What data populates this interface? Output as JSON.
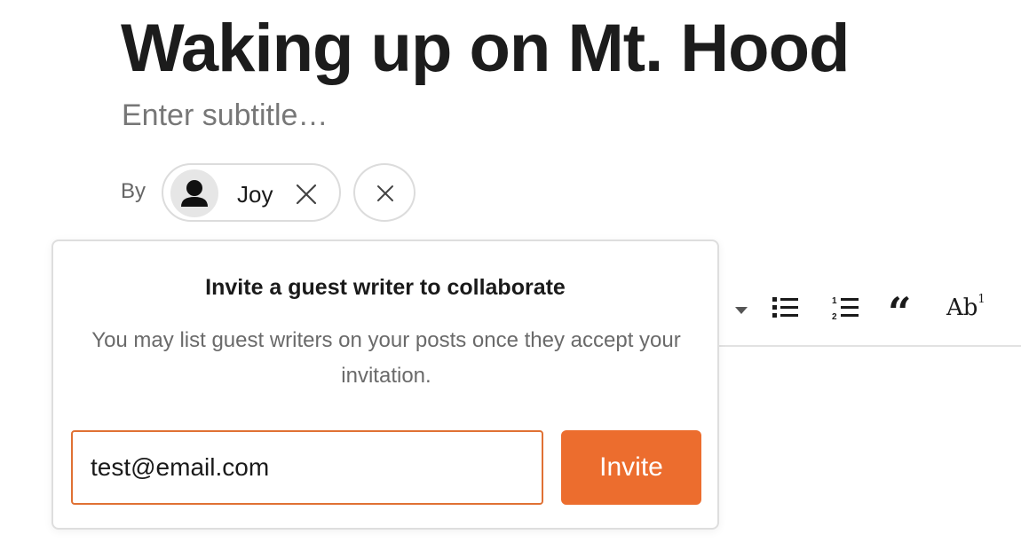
{
  "post": {
    "title": "Waking up on Mt. Hood",
    "subtitle_placeholder": "Enter subtitle…"
  },
  "byline": {
    "by_label": "By",
    "author": {
      "name": "Joy",
      "avatar_icon": "person-silhouette-icon",
      "remove_icon": "close-icon"
    },
    "add_author_icon": "close-icon"
  },
  "toolbar": {
    "items": [
      {
        "icon": "more-dropdown-icon",
        "label": "."
      },
      {
        "icon": "bulleted-list-icon"
      },
      {
        "icon": "numbered-list-icon"
      },
      {
        "icon": "blockquote-icon",
        "label": "“"
      },
      {
        "icon": "text-style-icon",
        "label": "Ab",
        "superscript": "1"
      }
    ]
  },
  "invite_popover": {
    "heading": "Invite a guest writer to collaborate",
    "description": "You may list guest writers on your posts once they accept your invitation.",
    "email_value": "test@email.com",
    "invite_label": "Invite",
    "accent_color": "#ec6d2e"
  }
}
